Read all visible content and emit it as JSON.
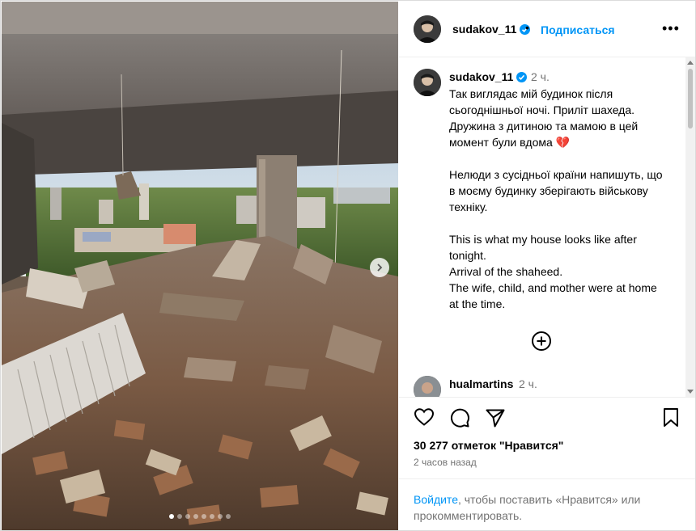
{
  "post": {
    "username": "sudakov_11",
    "follow_label": "Подписаться",
    "header_separator": "•",
    "more_label": "•••",
    "caption_time": "2 ч.",
    "caption": "Так виглядає мій будинок після сьогоднішньої ночі. Приліт шахеда. Дружина з дитиною та мамою в цей момент були вдома 💔\n\nНелюди з сусідньої країни напишуть, що в моєму будинку зберігають військову техніку.\n\nThis is what my house looks like after tonight.\nArrival of the shaheed.\nThe wife, child, and mother were at home at the time.",
    "likes_text": "30 277 отметок \"Нравится\"",
    "time_ago": "2 часов назад"
  },
  "comments": [
    {
      "username": "hualmartins",
      "time": "2 ч."
    }
  ],
  "login_prompt": {
    "link_text": "Войдите",
    "rest_text": ", чтобы поставить «Нравится» или прокомментировать."
  },
  "carousel": {
    "dot_count": 8,
    "active_index": 0
  },
  "icons": [
    "verified-badge-icon",
    "more-options-icon",
    "add-comment-icon",
    "heart-icon",
    "comment-icon",
    "share-icon",
    "bookmark-icon",
    "chevron-right-icon"
  ],
  "colors": {
    "accent": "#0095f6",
    "muted": "#737373",
    "border": "#dbdbdb"
  }
}
